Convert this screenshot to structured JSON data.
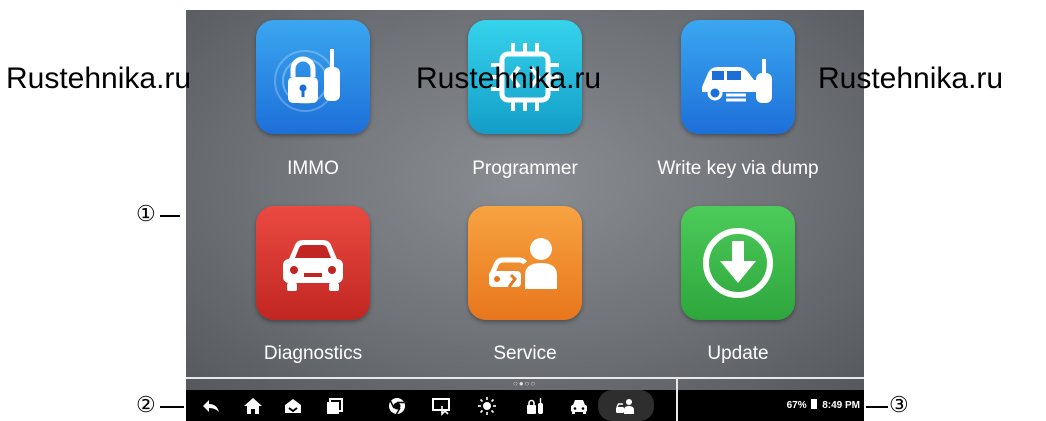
{
  "apps": [
    {
      "name": "immo",
      "label": "IMMO"
    },
    {
      "name": "programmer",
      "label": "Programmer"
    },
    {
      "name": "write-key-via-dump",
      "label": "Write key via dump"
    },
    {
      "name": "diagnostics",
      "label": "Diagnostics"
    },
    {
      "name": "service",
      "label": "Service"
    },
    {
      "name": "update",
      "label": "Update"
    }
  ],
  "page_indicator": "○●○○",
  "navbar": {
    "icons": [
      "back-icon",
      "home-icon",
      "vci-home-icon",
      "recent-apps-icon",
      "chrome-icon",
      "screenshot-icon",
      "brightness-icon",
      "immo-shortcut-icon",
      "car-diagnostics-icon",
      "service-shortcut-icon"
    ]
  },
  "status": {
    "battery": "67%",
    "time": "8:49 PM"
  },
  "watermark": "Rustehnika.ru",
  "callouts": {
    "one": "①",
    "two": "②",
    "three": "③"
  },
  "colors": {
    "immo": "#2f8ae6",
    "programmer": "#1fb8d9",
    "write_key": "#2f8ae6",
    "diagnostics": "#d9302c",
    "service": "#f08a2c",
    "update": "#3cb54a"
  }
}
